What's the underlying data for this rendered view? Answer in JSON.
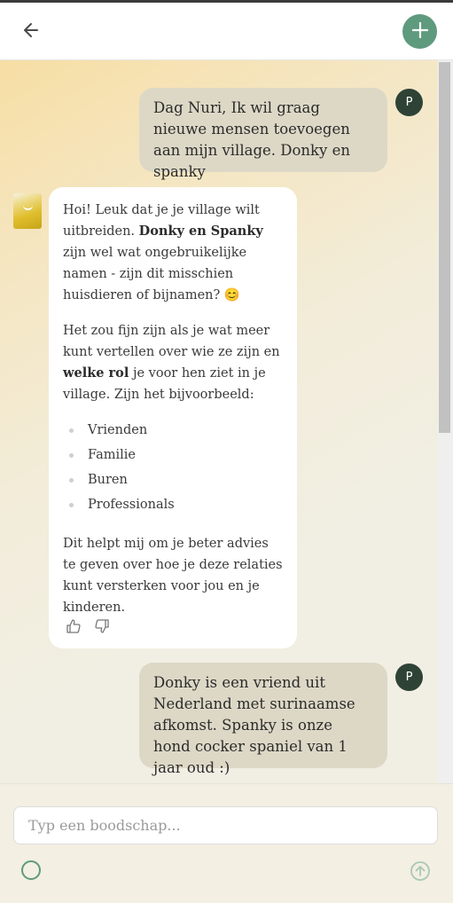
{
  "header": {
    "back_icon": "arrow-left-icon",
    "add_icon": "plus-icon"
  },
  "messages": [
    {
      "role": "user",
      "avatar_initial": "P",
      "text": "Dag Nuri, Ik wil graag nieuwe mensen toevoegen aan mijn village. Donky en spanky"
    },
    {
      "role": "assistant",
      "p1_a": "Hoi! Leuk dat je je village wilt uitbreiden. ",
      "p1_b": "Donky en Spanky",
      "p1_c": " zijn wel wat ongebruikelijke namen - zijn dit misschien huisdieren of bijnamen? 😊",
      "p2_a": "Het zou fijn zijn als je wat meer kunt vertellen over wie ze zijn en ",
      "p2_b": "welke rol",
      "p2_c": " je voor hen ziet in je village. Zijn het bijvoorbeeld:",
      "list": [
        "Vrienden",
        "Familie",
        "Buren",
        "Professionals"
      ],
      "p3": "Dit helpt mij om je beter advies te geven over hoe je deze relaties kunt versterken voor jou en je kinderen."
    },
    {
      "role": "user",
      "avatar_initial": "P",
      "text": "Donky is een vriend uit Nederland met surinaamse afkomst. Spanky is onze hond cocker spaniel van 1 jaar oud :)"
    }
  ],
  "composer": {
    "placeholder": "Typ een boodschap...",
    "value": ""
  },
  "colors": {
    "accent": "#5e9a7e",
    "user_avatar": "#2e4336",
    "user_bubble": "#ddd8c6"
  }
}
